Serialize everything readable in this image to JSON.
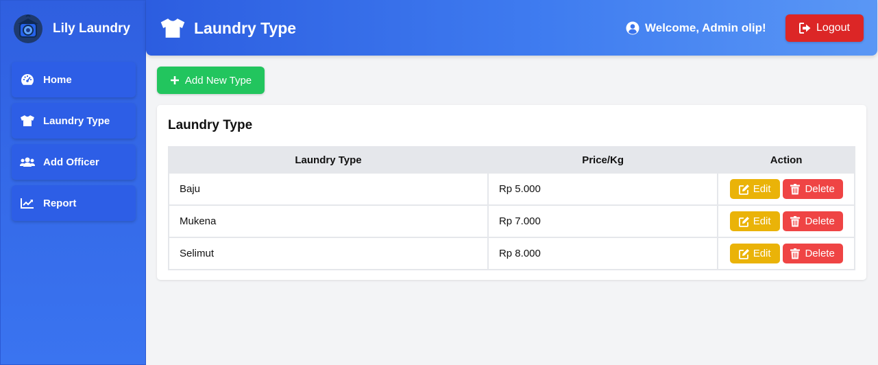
{
  "brand": {
    "name": "Lily Laundry",
    "logo_icon": "washing-machine-logo"
  },
  "sidebar": {
    "items": [
      {
        "label": "Home",
        "icon": "speedometer-icon"
      },
      {
        "label": "Laundry Type",
        "icon": "shirt-icon"
      },
      {
        "label": "Add Officer",
        "icon": "users-icon"
      },
      {
        "label": "Report",
        "icon": "chart-line-icon"
      }
    ]
  },
  "header": {
    "title": "Laundry Type",
    "title_icon": "shirt-icon",
    "welcome": "Welcome, Admin olip!",
    "logout_label": "Logout"
  },
  "toolbar": {
    "add_label": "Add New Type"
  },
  "table": {
    "title": "Laundry Type",
    "columns": [
      "Laundry Type",
      "Price/Kg",
      "Action"
    ],
    "rows": [
      {
        "type": "Baju",
        "price": "Rp 5.000"
      },
      {
        "type": "Mukena",
        "price": "Rp 7.000"
      },
      {
        "type": "Selimut",
        "price": "Rp 8.000"
      }
    ],
    "edit_label": "Edit",
    "delete_label": "Delete"
  },
  "colors": {
    "primary": "#2f5fe0",
    "success": "#22c55e",
    "danger": "#dc2626",
    "warning": "#eab308"
  }
}
